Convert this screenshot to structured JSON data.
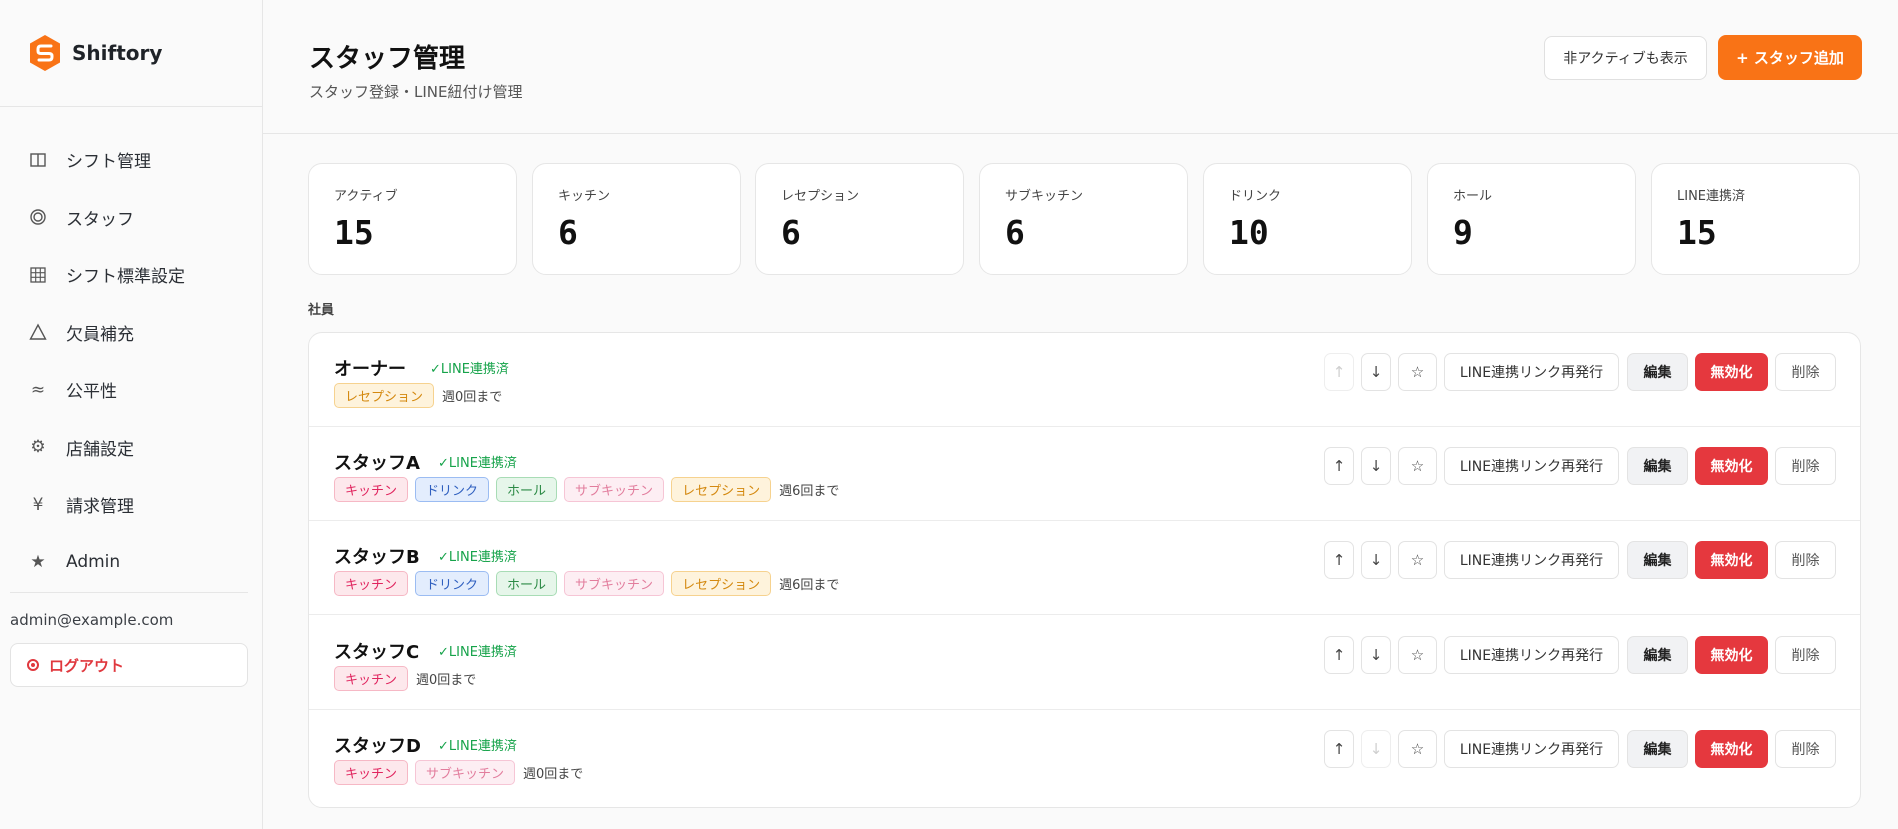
{
  "app": {
    "name": "Shiftory",
    "accent_color": "#f97316"
  },
  "sidebar": {
    "items": [
      {
        "label": "シフト管理",
        "icon": "columns-icon"
      },
      {
        "label": "スタッフ",
        "icon": "circle-icon"
      },
      {
        "label": "シフト標準設定",
        "icon": "grid-icon"
      },
      {
        "label": "欠員補充",
        "icon": "triangle-icon"
      },
      {
        "label": "公平性",
        "icon": "approx-icon"
      },
      {
        "label": "店舗設定",
        "icon": "gear-icon"
      },
      {
        "label": "請求管理",
        "icon": "yen-icon"
      },
      {
        "label": "Admin",
        "icon": "star-icon"
      }
    ],
    "user_email": "admin@example.com",
    "logout_label": "ログアウト"
  },
  "header": {
    "title": "スタッフ管理",
    "subtitle": "スタッフ登録・LINE紐付け管理",
    "show_inactive_label": "非アクティブも表示",
    "add_staff_label": "+ スタッフ追加"
  },
  "stats": [
    {
      "label": "アクティブ",
      "value": "15"
    },
    {
      "label": "キッチン",
      "value": "6"
    },
    {
      "label": "レセプション",
      "value": "6"
    },
    {
      "label": "サブキッチン",
      "value": "6"
    },
    {
      "label": "ドリンク",
      "value": "10"
    },
    {
      "label": "ホール",
      "value": "9"
    },
    {
      "label": "LINE連携済",
      "value": "15"
    }
  ],
  "section_label": "社員",
  "actions": {
    "up": "↑",
    "down": "↓",
    "star": "☆",
    "reissue_label": "LINE連携リンク再発行",
    "edit_label": "編集",
    "disable_label": "無効化",
    "delete_label": "削除"
  },
  "staff": [
    {
      "name": "オーナー",
      "line_status": "✓LINE連携済",
      "tags": [
        "レセプション"
      ],
      "frequency": "週0回まで",
      "up_disabled": true,
      "down_disabled": false
    },
    {
      "name": "スタッフA",
      "line_status": "✓LINE連携済",
      "tags": [
        "キッチン",
        "ドリンク",
        "ホール",
        "サブキッチン",
        "レセプション"
      ],
      "frequency": "週6回まで",
      "up_disabled": false,
      "down_disabled": false
    },
    {
      "name": "スタッフB",
      "line_status": "✓LINE連携済",
      "tags": [
        "キッチン",
        "ドリンク",
        "ホール",
        "サブキッチン",
        "レセプション"
      ],
      "frequency": "週6回まで",
      "up_disabled": false,
      "down_disabled": false
    },
    {
      "name": "スタッフC",
      "line_status": "✓LINE連携済",
      "tags": [
        "キッチン"
      ],
      "frequency": "週0回まで",
      "up_disabled": false,
      "down_disabled": false
    },
    {
      "name": "スタッフD",
      "line_status": "✓LINE連携済",
      "tags": [
        "キッチン",
        "サブキッチン"
      ],
      "frequency": "週0回まで",
      "up_disabled": false,
      "down_disabled": true
    }
  ],
  "tag_styles": {
    "キッチン": "tag-kitchen",
    "ドリンク": "tag-drink",
    "ホール": "tag-hall",
    "サブキッチン": "tag-sub",
    "レセプション": "tag-reception"
  }
}
